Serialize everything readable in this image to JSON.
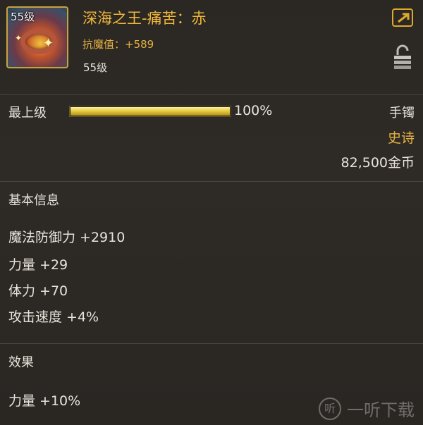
{
  "item": {
    "level_badge": "55级",
    "name": "深海之王-痛苦：赤",
    "resist_label": "抗魔值：",
    "resist_value": "+589",
    "required_level": "55级"
  },
  "upgrade": {
    "label": "最上级",
    "progress_percent": 100,
    "percent_text": "100%"
  },
  "meta": {
    "slot_type": "手镯",
    "rarity": "史诗",
    "price": "82,500金币"
  },
  "basic_info": {
    "title": "基本信息",
    "stats": [
      "魔法防御力 +2910",
      "力量 +29",
      "体力 +70",
      "攻击速度 +4%"
    ]
  },
  "effects": {
    "title": "效果",
    "stats": [
      "力量 +10%"
    ]
  },
  "watermark": {
    "logo": "听",
    "text": "一听下载"
  },
  "colors": {
    "gold": "#e6b241",
    "item_name": "#f0b73a",
    "background": "#2c2925"
  },
  "icons": [
    "bracelet-item-icon",
    "share-icon",
    "lock-icon"
  ]
}
